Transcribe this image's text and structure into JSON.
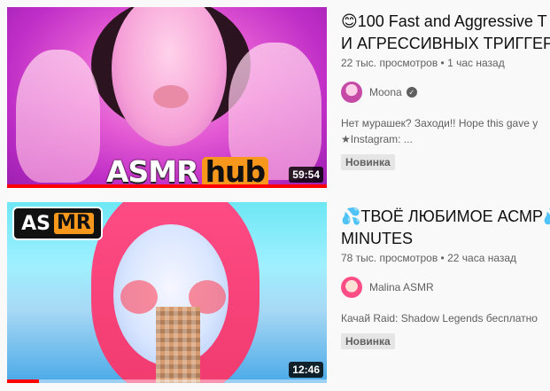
{
  "results": [
    {
      "title": "😊100 Fast and Aggressive T",
      "title_line2": "И АГРЕССИВНЫХ ТРИГГЕРО",
      "views": "22 тыс. просмотров",
      "separator": "•",
      "age": "1 час назад",
      "channel": "Moona",
      "verified": true,
      "description_line1": "Нет мурашек? Заходи!! Hope this gave y",
      "description_line2": "★Instagram: ...",
      "badge": "Новинка",
      "duration": "59:54",
      "watched_fraction": 1.0,
      "thumb_logo_left": "ASMR",
      "thumb_logo_right": "hub"
    },
    {
      "title": "💦ТВОЁ ЛЮБИМОЕ АСМР💦",
      "title_line2": "MINUTES",
      "views": "78 тыс. просмотров",
      "separator": "•",
      "age": "22 часа назад",
      "channel": "Malina ASMR",
      "verified": false,
      "description_line1": "Качай Raid: Shadow Legends бесплатно",
      "description_line2": "",
      "badge": "Новинка",
      "duration": "12:46",
      "watched_fraction": 0.1,
      "thumb_logo_left": "AS",
      "thumb_logo_right": "MR"
    }
  ],
  "colors": {
    "progress": "#ff0000",
    "text_primary": "#0f0f0f",
    "text_secondary": "#606060",
    "badge_bg": "#e5e5e5"
  },
  "icons": {
    "verified": "check-circle-icon"
  }
}
